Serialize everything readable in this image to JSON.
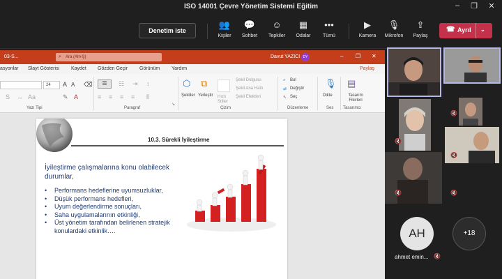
{
  "window": {
    "title": "ISO 14001 Çevre Yönetim Sistemi Eğitim",
    "controls": [
      "–",
      "❐",
      "✕"
    ]
  },
  "toolbar": {
    "request_control": "Denetim iste",
    "items": [
      {
        "icon": "people-icon",
        "glyph": "👥",
        "label": "Kişiler"
      },
      {
        "icon": "chat-icon",
        "glyph": "💬",
        "label": "Sohbet"
      },
      {
        "icon": "reactions-icon",
        "glyph": "☺",
        "label": "Tepkiler"
      },
      {
        "icon": "rooms-icon",
        "glyph": "▦",
        "label": "Odalar"
      },
      {
        "icon": "more-icon",
        "glyph": "•••",
        "label": "Tümü"
      },
      {
        "icon": "camera-icon",
        "glyph": "▶",
        "label": "Kamera"
      },
      {
        "icon": "microphone-icon",
        "glyph": "🎙",
        "label": "Mikrofon"
      },
      {
        "icon": "share-icon",
        "glyph": "⇪",
        "label": "Paylaş"
      }
    ],
    "leave": {
      "label": "Ayrıl",
      "glyph": "☎",
      "chevron": "⌄",
      "color": "#c4314b"
    }
  },
  "ppt": {
    "file_name": "03-S...",
    "search_placeholder": "Ara (Alt+Ş)",
    "user_name": "Davut YAZICI",
    "user_initials": "DY",
    "window_controls": [
      "–",
      "❐",
      "✕"
    ],
    "tabs": [
      "asyonlar",
      "Slayt Gösterisi",
      "Kaydet",
      "Gözden Geçir",
      "Görünüm",
      "Yardım"
    ],
    "share_label": "Paylaş",
    "ribbon": {
      "font_size": "24",
      "group_labels": [
        "Yazı Tipi",
        "Paragraf",
        "Çizim",
        "Düzenleme",
        "Ses",
        "Tasarımcı"
      ],
      "shapes": "Şekiller",
      "arrange": "Yerleştir",
      "quick_styles": "Hızlı Stiller",
      "shape_fill": "Şekil Dolgusu",
      "shape_outline": "Şekil Ana Hattı",
      "shape_effects": "Şekil Efektleri",
      "find": "Bul",
      "replace": "Değiştir",
      "select": "Seç",
      "dictate": "Dikte",
      "designer": "Tasarım Fikirleri"
    },
    "slide": {
      "heading": "10.3. Sürekli İyileştirme",
      "intro": "İyileştirme çalışmalarına konu olabilecek durumlar,",
      "bullets": [
        "Performans hedeflerine uyumsuzluklar,",
        "Düşük performans hedefleri,",
        "Uyum değerlendirme sonuçları,",
        "Saha uygulamalarının etkinliği,",
        "Üst yönetim tarafından belirlenen stratejik konulardaki etkinlik…."
      ]
    }
  },
  "participants": {
    "ah_initials": "AH",
    "ah_name": "ahmet emin...",
    "overflow_count": "+18",
    "mute_glyph": "🔇"
  },
  "colors": {
    "accent_ppt": "#c43e1c",
    "leave": "#c4314b",
    "slide_text": "#1f3b73"
  }
}
